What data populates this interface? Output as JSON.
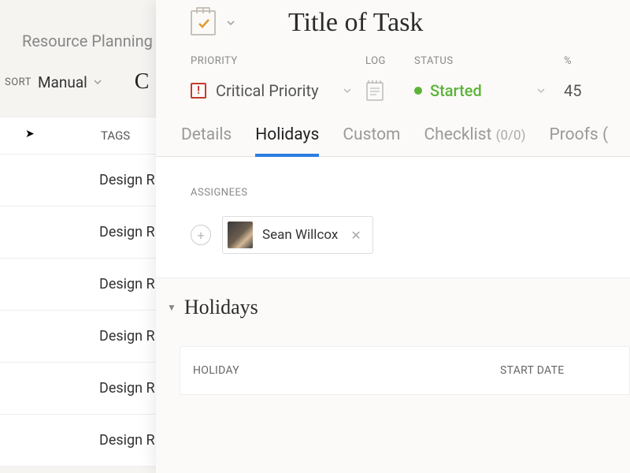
{
  "background": {
    "header": "Resource Planning",
    "sort_label": "SORT",
    "sort_value": "Manual",
    "tags_header": "TAGS",
    "big_c": "C",
    "rows": [
      "Design R",
      "Design R",
      "Design R",
      "Design R",
      "Design R",
      "Design R"
    ]
  },
  "panel": {
    "title": "Title of Task",
    "fields": {
      "priority_label": "PRIORITY",
      "priority_value": "Critical Priority",
      "log_label": "LOG",
      "status_label": "STATUS",
      "status_value": "Started",
      "pct_label": "%",
      "pct_value": "45"
    },
    "tabs": {
      "details": "Details",
      "holidays": "Holidays",
      "custom": "Custom",
      "checklist": "Checklist",
      "checklist_count": "(0/0)",
      "proofs": "Proofs ("
    },
    "assignees": {
      "label": "ASSIGNEES",
      "items": [
        {
          "name": "Sean Willcox"
        }
      ]
    },
    "holidays_section": {
      "title": "Holidays",
      "columns": {
        "holiday": "HOLIDAY",
        "start_date": "START DATE"
      }
    }
  }
}
